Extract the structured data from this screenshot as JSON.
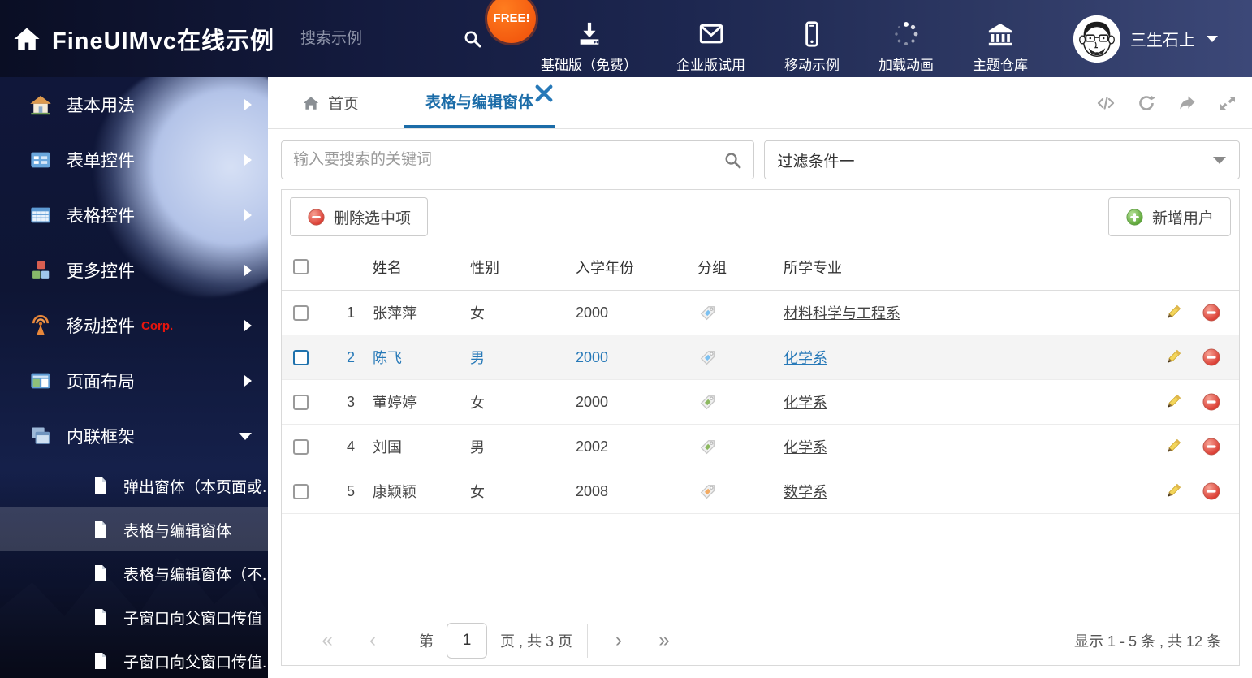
{
  "header": {
    "title": "FineUIMvc在线示例",
    "search_placeholder": "搜索示例",
    "free_badge": "FREE!",
    "nav_items": [
      {
        "icon": "download-icon",
        "label": "基础版（免费）"
      },
      {
        "icon": "envelope-icon",
        "label": "企业版试用"
      },
      {
        "icon": "mobile-icon",
        "label": "移动示例"
      },
      {
        "icon": "spinner-icon",
        "label": "加载动画"
      },
      {
        "icon": "bank-icon",
        "label": "主题仓库"
      }
    ],
    "user": {
      "name": "三生石上"
    }
  },
  "sidebar": {
    "items": [
      {
        "icon": "home-icon",
        "label": "基本用法"
      },
      {
        "icon": "form-icon",
        "label": "表单控件"
      },
      {
        "icon": "table-icon",
        "label": "表格控件"
      },
      {
        "icon": "cubes-icon",
        "label": "更多控件"
      },
      {
        "icon": "antenna-icon",
        "label": "移动控件",
        "badge": "Corp."
      },
      {
        "icon": "layout-icon",
        "label": "页面布局"
      },
      {
        "icon": "frames-icon",
        "label": "内联框架",
        "expanded": true
      }
    ],
    "subitems": [
      {
        "label": "弹出窗体（本页面或...",
        "active": false
      },
      {
        "label": "表格与编辑窗体",
        "active": true
      },
      {
        "label": "表格与编辑窗体（不...",
        "active": false
      },
      {
        "label": "子窗口向父窗口传值",
        "active": false
      },
      {
        "label": "子窗口向父窗口传值...",
        "active": false
      }
    ]
  },
  "tabs": {
    "home_label": "首页",
    "active_label": "表格与编辑窗体"
  },
  "filters": {
    "search_placeholder": "输入要搜索的关键词",
    "filter_selected": "过滤条件一"
  },
  "grid_toolbar": {
    "delete_label": "删除选中项",
    "add_label": "新增用户"
  },
  "table": {
    "columns": {
      "name": "姓名",
      "gender": "性别",
      "year": "入学年份",
      "group": "分组",
      "major": "所学专业"
    },
    "rows": [
      {
        "num": "1",
        "name": "张萍萍",
        "gender": "女",
        "year": "2000",
        "tag_color": "#7cc0f0",
        "major": "材料科学与工程系",
        "selected": false
      },
      {
        "num": "2",
        "name": "陈飞",
        "gender": "男",
        "year": "2000",
        "tag_color": "#7cc0f0",
        "major": "化学系",
        "selected": true
      },
      {
        "num": "3",
        "name": "董婷婷",
        "gender": "女",
        "year": "2000",
        "tag_color": "#8cb860",
        "major": "化学系",
        "selected": false
      },
      {
        "num": "4",
        "name": "刘国",
        "gender": "男",
        "year": "2002",
        "tag_color": "#8cb860",
        "major": "化学系",
        "selected": false
      },
      {
        "num": "5",
        "name": "康颖颖",
        "gender": "女",
        "year": "2008",
        "tag_color": "#f2aa62",
        "major": "数学系",
        "selected": false
      }
    ]
  },
  "pagination": {
    "page_prefix": "第",
    "page_value": "1",
    "page_suffix": "页 , 共 3 页",
    "summary": "显示 1 - 5 条 , 共 12 条",
    "icons": {
      "first": "«",
      "prev": "‹",
      "next": "›",
      "last": "»"
    }
  },
  "colors": {
    "accent_blue": "#1b6ca8",
    "selected_row_text": "#2779b8",
    "selected_row_bg": "#f4f4f4",
    "delete_red": "#d9342b",
    "add_green": "#4da32f",
    "free_badge_orange": "#ef4d09",
    "header_bg": "#141b3f",
    "pencil_yellow": "#f3d55b"
  }
}
